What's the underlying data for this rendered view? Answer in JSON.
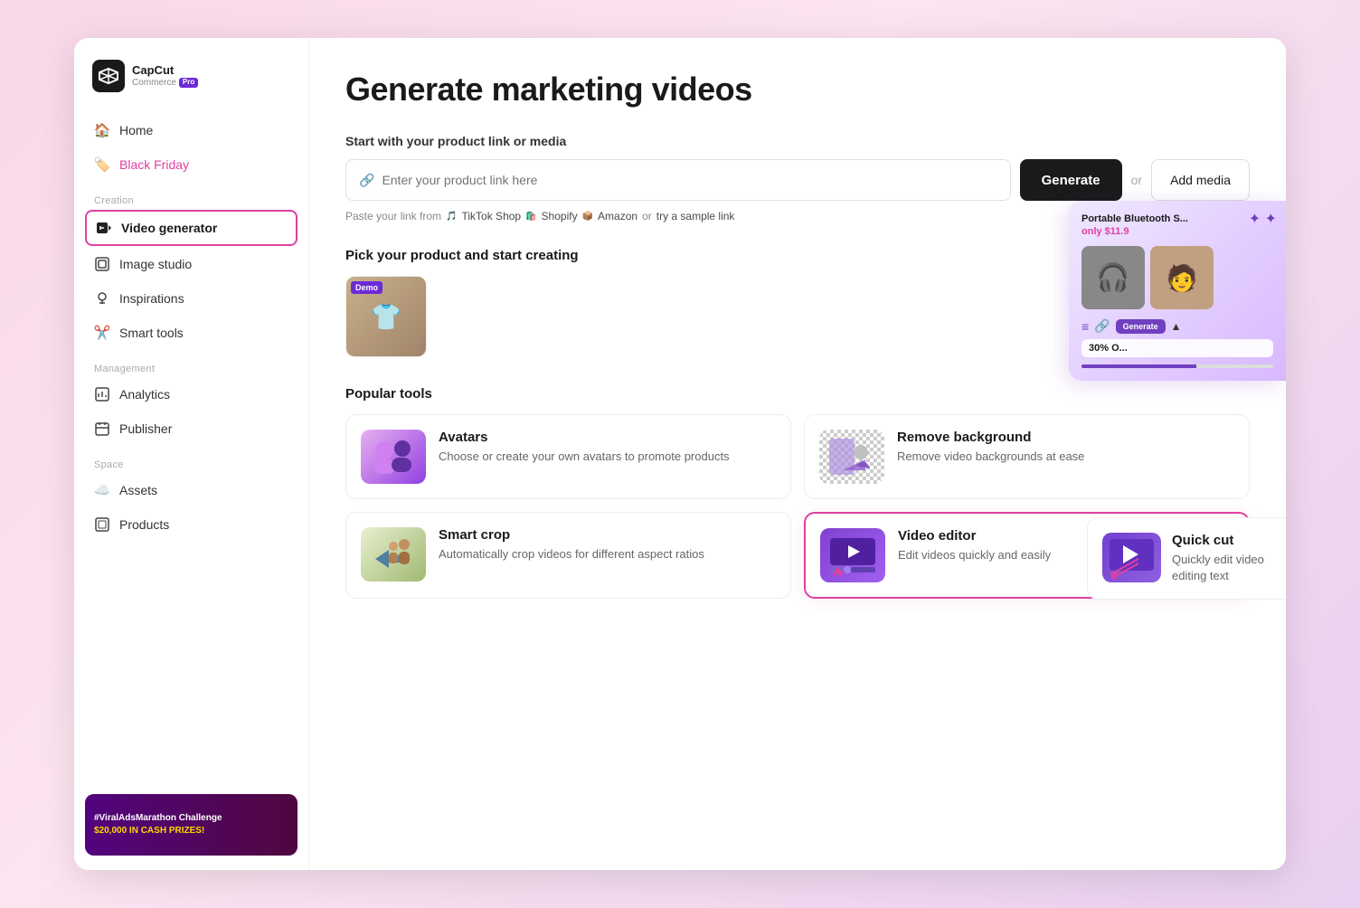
{
  "app": {
    "logo_brand": "CapCut",
    "logo_sub": "Commerce",
    "logo_pro": "Pro"
  },
  "sidebar": {
    "nav_items": [
      {
        "id": "home",
        "label": "Home",
        "icon": "🏠",
        "active": false,
        "special": ""
      },
      {
        "id": "black-friday",
        "label": "Black Friday",
        "icon": "🏷️",
        "active": false,
        "special": "black-friday"
      }
    ],
    "sections": [
      {
        "label": "Creation",
        "items": [
          {
            "id": "video-generator",
            "label": "Video generator",
            "icon": "📹",
            "active": true
          },
          {
            "id": "image-studio",
            "label": "Image studio",
            "icon": "🖼️",
            "active": false
          },
          {
            "id": "inspirations",
            "label": "Inspirations",
            "icon": "💡",
            "active": false
          },
          {
            "id": "smart-tools",
            "label": "Smart tools",
            "icon": "✂️",
            "active": false
          }
        ]
      },
      {
        "label": "Management",
        "items": [
          {
            "id": "analytics",
            "label": "Analytics",
            "icon": "📊",
            "active": false
          },
          {
            "id": "publisher",
            "label": "Publisher",
            "icon": "📅",
            "active": false
          }
        ]
      },
      {
        "label": "Space",
        "items": [
          {
            "id": "assets",
            "label": "Assets",
            "icon": "☁️",
            "active": false
          },
          {
            "id": "products",
            "label": "Products",
            "icon": "📦",
            "active": false
          }
        ]
      }
    ],
    "promo": {
      "hashtag": "#ViralAdsMarathon Challenge",
      "prize": "$20,000 IN CASH PRIZES!"
    }
  },
  "main": {
    "title": "Generate marketing videos",
    "input_section": {
      "label": "Start with your product link or media",
      "placeholder": "Enter your product link here",
      "generate_btn": "Generate",
      "or_text": "or",
      "add_media_btn": "Add media",
      "hint_prefix": "Paste your link from",
      "platforms": [
        "TikTok Shop",
        "Shopify",
        "Amazon"
      ],
      "hint_suffix": "or",
      "sample_link": "try a sample link"
    },
    "pick_section": {
      "label": "Pick your product and start creating",
      "products": [
        {
          "id": "shirt",
          "label": "White shirt",
          "has_demo": true
        }
      ]
    },
    "popular_tools": {
      "label": "Popular tools",
      "tools": [
        {
          "id": "avatars",
          "name": "Avatars",
          "desc": "Choose or create your own avatars to promote products",
          "highlighted": false
        },
        {
          "id": "remove-background",
          "name": "Remove background",
          "desc": "Remove video backgrounds at ease",
          "highlighted": false
        },
        {
          "id": "quick-cut",
          "name": "Quick cut",
          "desc": "Quickly edit video editing text",
          "highlighted": false
        },
        {
          "id": "smart-crop",
          "name": "Smart crop",
          "desc": "Automatically crop videos for different aspect ratios",
          "highlighted": false
        },
        {
          "id": "video-editor",
          "name": "Video editor",
          "desc": "Edit videos quickly and easily",
          "highlighted": true
        }
      ]
    }
  },
  "right_preview": {
    "product_name": "Portable Bluetooth S...",
    "price": "only $11.9",
    "discount": "30% O...",
    "generate_btn": "Generate"
  }
}
